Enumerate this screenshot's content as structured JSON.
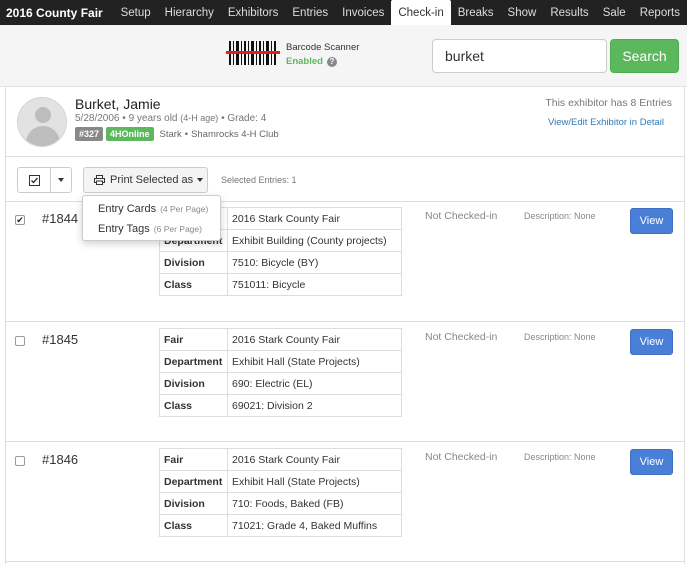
{
  "navbar": {
    "brand": "2016 County Fair",
    "items": [
      {
        "label": "Setup"
      },
      {
        "label": "Hierarchy"
      },
      {
        "label": "Exhibitors"
      },
      {
        "label": "Entries"
      },
      {
        "label": "Invoices"
      },
      {
        "label": "Check-in"
      },
      {
        "label": "Breaks"
      },
      {
        "label": "Show"
      },
      {
        "label": "Results"
      },
      {
        "label": "Sale"
      },
      {
        "label": "Reports"
      }
    ],
    "active": "Check-in"
  },
  "scanner": {
    "label": "Barcode Scanner",
    "status": "Enabled",
    "status_color": "#5cb85c"
  },
  "search": {
    "value": "burket",
    "button_label": "Search"
  },
  "exhibitor": {
    "name": "Burket, Jamie",
    "birthdate": "5/28/2006",
    "age": "9 years old",
    "age_note": "(4-H age)",
    "grade": "Grade: 4",
    "id_badge": "#327",
    "source_badge": "4HOnline",
    "county": "Stark",
    "club": "Shamrocks 4-H Club",
    "entries_text": "This exhibitor has 8 Entries",
    "view_link": "View/Edit Exhibitor in Detail"
  },
  "toolbar": {
    "print_label": "Print Selected as",
    "selected_text": "Selected Entries: 1"
  },
  "print_menu": [
    {
      "label": "Entry Cards",
      "hint": "(4 Per Page)"
    },
    {
      "label": "Entry Tags",
      "hint": "(6 Per Page)"
    }
  ],
  "field_labels": {
    "fair": "Fair",
    "department": "Department",
    "division": "Division",
    "class": "Class"
  },
  "entries": [
    {
      "number": "#1844",
      "checked": true,
      "fair": "2016 Stark   County Fair",
      "department": "Exhibit Building (County projects)",
      "division": "7510: Bicycle (BY)",
      "class": "751011: Bicycle",
      "status": "Not Checked-in",
      "description": "Description: None",
      "view_label": "View"
    },
    {
      "number": "#1845",
      "checked": false,
      "fair": "2016 Stark   County Fair",
      "department": "Exhibit Hall (State Projects)",
      "division": "690: Electric (EL)",
      "class": "69021: Division 2",
      "status": "Not Checked-in",
      "description": "Description: None",
      "view_label": "View"
    },
    {
      "number": "#1846",
      "checked": false,
      "fair": "2016 Stark   County Fair",
      "department": "Exhibit Hall (State Projects)",
      "division": "710: Foods, Baked (FB)",
      "class": "71021: Grade 4, Baked Muffins",
      "status": "Not Checked-in",
      "description": "Description: None",
      "view_label": "View"
    }
  ],
  "colors": {
    "nav_bg": "#222222",
    "success": "#5cb85c",
    "primary": "#4a7fd8",
    "link": "#337ab7"
  }
}
